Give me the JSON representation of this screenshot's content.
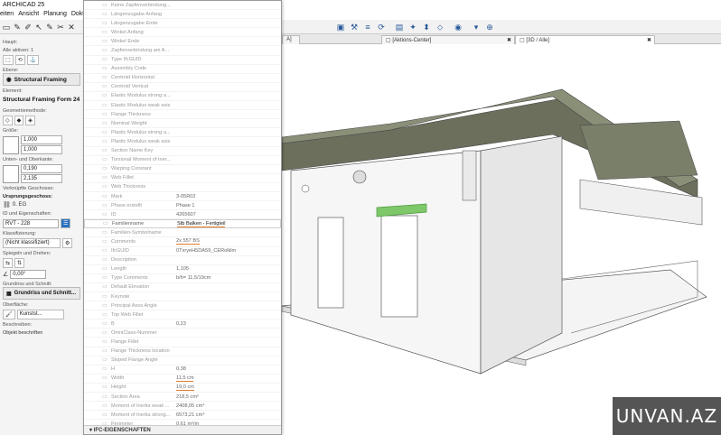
{
  "app": {
    "title": "ARCHICAD 25"
  },
  "menu": [
    "eiten",
    "Ansicht",
    "Planung",
    "Doku"
  ],
  "infobox": {
    "haupt_label": "Haupt:",
    "alle_aktiven": "Alle aktiven: 1",
    "ebene_label": "Ebene:",
    "ebene_value": "Structural Framing",
    "element_label": "Element:",
    "element_value": "Structural Framing Form 24",
    "geometrie_label": "Geometriemethode:",
    "groesse_label": "Größe:",
    "size_1": "1,000",
    "size_2": "1,000",
    "unten_label": "Unten- und Oberkante:",
    "height_1": "0,190",
    "height_2": "2,135",
    "geschoss_label": "Verknüpfte Geschosse:",
    "ursprung_label": "Ursprungsgeschoss:",
    "ursprung_value": "0. EG",
    "id_label": "ID und Eigenschaften:",
    "id_value": "RVT - 228",
    "klass_label": "Klassifizierung:",
    "klass_value": "(Nicht klassifiziert)",
    "spiegeln_label": "Spiegeln und Drehen:",
    "angle_value": "0,00°",
    "grundriss_label": "Grundriss und Schnitt:",
    "grundriss_value": "Grundriss und Schnitt...",
    "oberflaeche_label": "Oberfläche:",
    "oberflaeche_value": "Kunstst...",
    "beschreiben_label": "Beschreiben:",
    "beschreiben_value": "Objekt beschriften"
  },
  "properties": [
    {
      "name": "Keine Zapfenverbindung...",
      "value": ""
    },
    {
      "name": "Längenzugabe Anfang",
      "value": ""
    },
    {
      "name": "Längenzugabe Ende",
      "value": ""
    },
    {
      "name": "Winkel Anfang",
      "value": ""
    },
    {
      "name": "Winkel Ende",
      "value": ""
    },
    {
      "name": "Zapfenverbindung am A...",
      "value": ""
    },
    {
      "name": "Type IfcGUID",
      "value": ""
    },
    {
      "name": "Assembly Code",
      "value": ""
    },
    {
      "name": "Centroid Horizontal",
      "value": ""
    },
    {
      "name": "Centroid Vertical",
      "value": ""
    },
    {
      "name": "Elastic Modulus strong a...",
      "value": ""
    },
    {
      "name": "Elastic Modulus weak axis",
      "value": ""
    },
    {
      "name": "Flange Thickness",
      "value": ""
    },
    {
      "name": "Nominal Weight",
      "value": ""
    },
    {
      "name": "Plastic Modulus strong a...",
      "value": ""
    },
    {
      "name": "Plastic Modulus weak axis",
      "value": ""
    },
    {
      "name": "Section Name Key",
      "value": ""
    },
    {
      "name": "Torsional Moment of Iner...",
      "value": ""
    },
    {
      "name": "Warping Constant",
      "value": ""
    },
    {
      "name": "Web Fillet",
      "value": ""
    },
    {
      "name": "Web Thickness",
      "value": ""
    },
    {
      "name": "Mark",
      "value": "3-05R02"
    },
    {
      "name": "Phase erstellt",
      "value": "Phase 1"
    },
    {
      "name": "ID",
      "value": "4265607"
    },
    {
      "name": "Familienname",
      "value": "Stb Balken - Fertigteil"
    },
    {
      "name": "Familien-Symbolname",
      "value": ""
    },
    {
      "name": "Comments",
      "value": "2x 557 BS"
    },
    {
      "name": "IfcGUID",
      "value": "0TxryeH5DA59_CERolklm"
    },
    {
      "name": "Description",
      "value": ""
    },
    {
      "name": "Length",
      "value": "1,105"
    },
    {
      "name": "Type Comments",
      "value": "b/h= 11,5/19cm"
    },
    {
      "name": "Default Elevation",
      "value": ""
    },
    {
      "name": "Keynote",
      "value": ""
    },
    {
      "name": "Principal Axes Angle",
      "value": ""
    },
    {
      "name": "Top Web Fillet",
      "value": ""
    },
    {
      "name": "B",
      "value": "0,23"
    },
    {
      "name": "OmniClass-Nummer",
      "value": ""
    },
    {
      "name": "Flange Fillet",
      "value": ""
    },
    {
      "name": "Flange Thickness location",
      "value": ""
    },
    {
      "name": "Sloped Flange Angle",
      "value": ""
    },
    {
      "name": "H",
      "value": "0,38"
    },
    {
      "name": "Width",
      "value": "11,5 cm"
    },
    {
      "name": "Height",
      "value": "19,0 cm"
    },
    {
      "name": "Section Area",
      "value": "218,5 cm²"
    },
    {
      "name": "Moment of Inertia weak ...",
      "value": "2408,05 cm⁴"
    },
    {
      "name": "Moment of Inertia strong...",
      "value": "6573,21 cm⁴"
    },
    {
      "name": "Perimeter",
      "value": "0,61 m²/m"
    }
  ],
  "properties_footer": "IFC-EIGENSCHAFTEN",
  "tabs": [
    {
      "label": "A]"
    },
    {
      "label": "[Aktions-Center]"
    },
    {
      "label": "[3D / Alle]"
    }
  ],
  "watermark": "UNVAN.AZ",
  "colors": {
    "roof": "#8a8f78",
    "roof_dark": "#6b6f5c",
    "wall": "#f2f2f2",
    "selected_beam": "#7fc86a",
    "underline": "#e07c2a"
  }
}
